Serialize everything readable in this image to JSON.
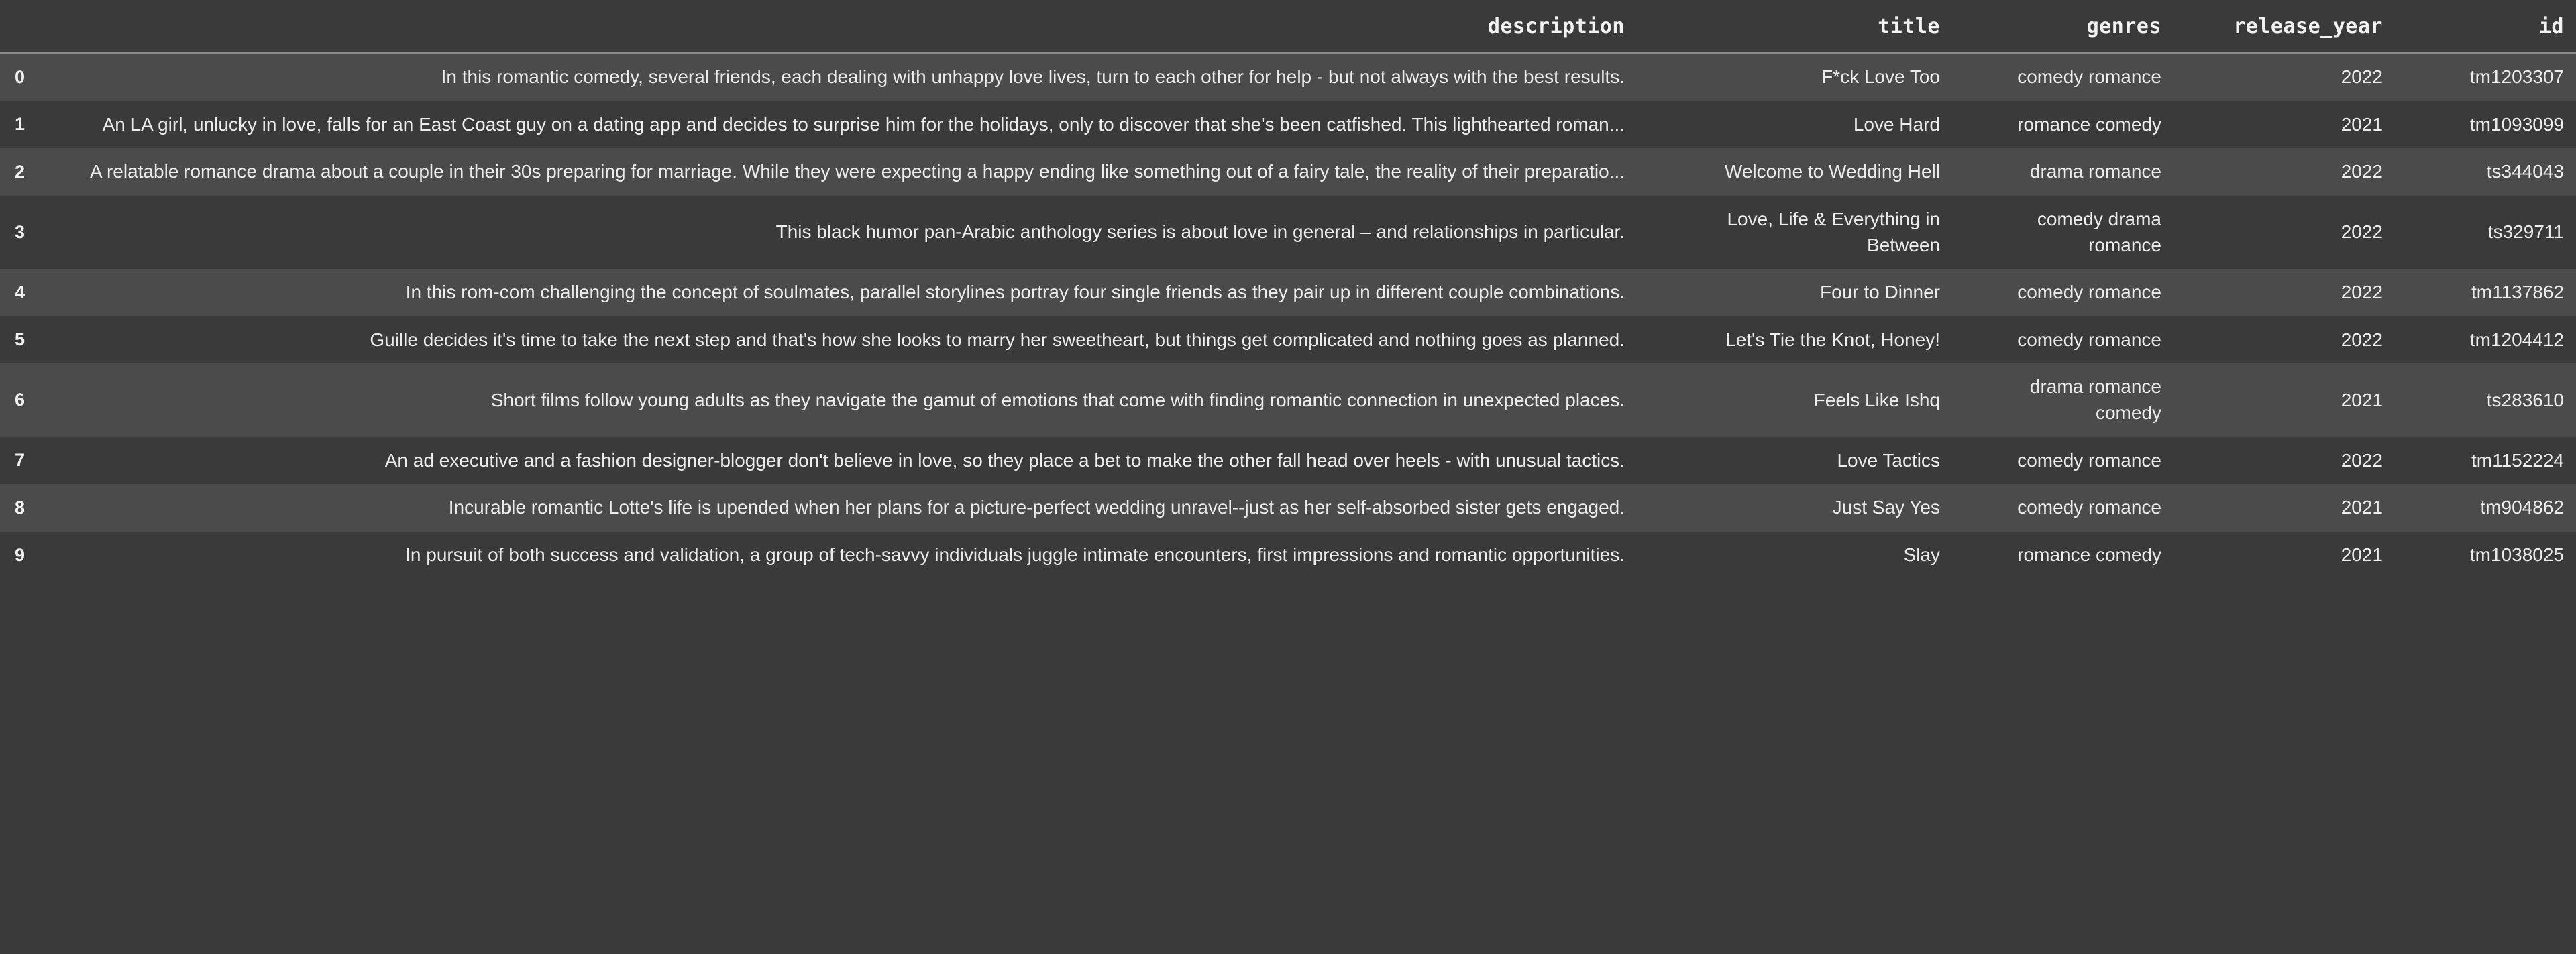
{
  "table": {
    "columns": [
      {
        "key": "index",
        "label": "",
        "align": "left"
      },
      {
        "key": "description",
        "label": "description",
        "align": "right"
      },
      {
        "key": "title",
        "label": "title",
        "align": "right"
      },
      {
        "key": "genres",
        "label": "genres",
        "align": "right"
      },
      {
        "key": "release_year",
        "label": "release_year",
        "align": "right"
      },
      {
        "key": "id",
        "label": "id",
        "align": "right"
      }
    ],
    "rows": [
      {
        "index": "0",
        "description": "In this romantic comedy, several friends, each dealing with unhappy love lives, turn to each other for help - but not always with the best results.",
        "title": "F*ck Love Too",
        "genres": "comedy romance",
        "release_year": "2022",
        "id": "tm1203307"
      },
      {
        "index": "1",
        "description": "An LA girl, unlucky in love, falls for an East Coast guy on a dating app and decides to surprise him for the holidays, only to discover that she's been catfished. This lighthearted roman...",
        "title": "Love Hard",
        "genres": "romance comedy",
        "release_year": "2021",
        "id": "tm1093099"
      },
      {
        "index": "2",
        "description": "A relatable romance drama about a couple in their 30s preparing for marriage. While they were expecting a happy ending like something out of a fairy tale, the reality of their preparatio...",
        "title": "Welcome to Wedding Hell",
        "genres": "drama romance",
        "release_year": "2022",
        "id": "ts344043"
      },
      {
        "index": "3",
        "description": "This black humor pan-Arabic anthology series is about love in general – and relationships in particular.",
        "title": "Love, Life & Everything in Between",
        "genres": "comedy drama romance",
        "release_year": "2022",
        "id": "ts329711"
      },
      {
        "index": "4",
        "description": "In this rom-com challenging the concept of soulmates, parallel storylines portray four single friends as they pair up in different couple combinations.",
        "title": "Four to Dinner",
        "genres": "comedy romance",
        "release_year": "2022",
        "id": "tm1137862"
      },
      {
        "index": "5",
        "description": "Guille decides it's time to take the next step and that's how she looks to marry her sweetheart, but things get complicated and nothing goes as planned.",
        "title": "Let's Tie the Knot, Honey!",
        "genres": "comedy romance",
        "release_year": "2022",
        "id": "tm1204412"
      },
      {
        "index": "6",
        "description": "Short films follow young adults as they navigate the gamut of emotions that come with finding romantic connection in unexpected places.",
        "title": "Feels Like Ishq",
        "genres": "drama romance comedy",
        "release_year": "2021",
        "id": "ts283610"
      },
      {
        "index": "7",
        "description": "An ad executive and a fashion designer-blogger don't believe in love, so they place a bet to make the other fall head over heels - with unusual tactics.",
        "title": "Love Tactics",
        "genres": "comedy romance",
        "release_year": "2022",
        "id": "tm1152224"
      },
      {
        "index": "8",
        "description": "Incurable romantic Lotte's life is upended when her plans for a picture-perfect wedding unravel--just as her self-absorbed sister gets engaged.",
        "title": "Just Say Yes",
        "genres": "comedy romance",
        "release_year": "2021",
        "id": "tm904862"
      },
      {
        "index": "9",
        "description": "In pursuit of both success and validation, a group of tech-savvy individuals juggle intimate encounters, first impressions and romantic opportunities.",
        "title": "Slay",
        "genres": "romance comedy",
        "release_year": "2021",
        "id": "tm1038025"
      }
    ]
  },
  "theme": {
    "background": "#3a3a3a",
    "row_even": "#4b4b4b",
    "row_odd": "#3a3a3a",
    "text": "#ececec",
    "header_rule": "#8a8a8a"
  }
}
